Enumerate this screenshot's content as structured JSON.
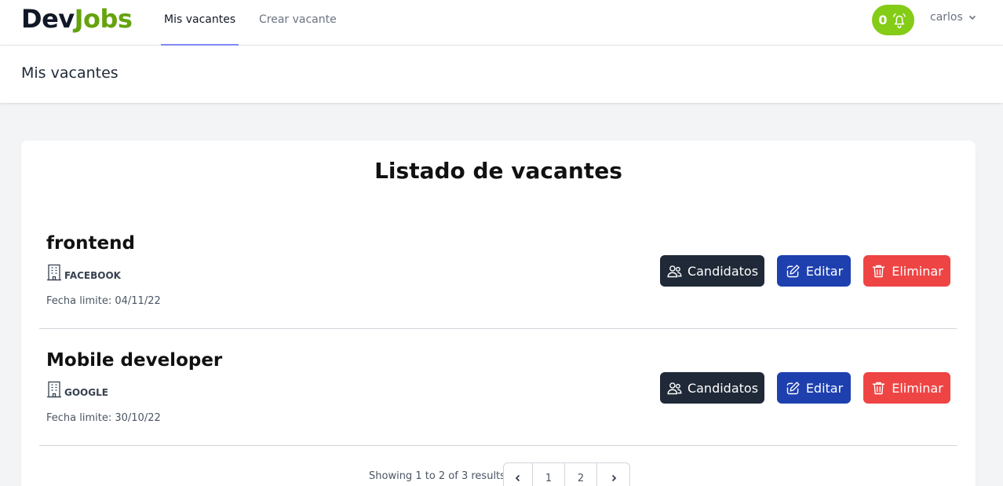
{
  "nav": {
    "logo_part1": "Dev",
    "logo_part2": "Jobs",
    "links": [
      {
        "label": "Mis vacantes",
        "active": true
      },
      {
        "label": "Crear vacante",
        "active": false
      }
    ],
    "notification_count": "0",
    "user_name": "carlos",
    "icons": {
      "notification": "bell-icon",
      "user_menu": "chevron-down-icon"
    }
  },
  "page_header": {
    "title": "Mis vacantes"
  },
  "card": {
    "title": "Listado de vacantes",
    "vacancies": [
      {
        "title": "frontend",
        "company": "FACEBOOK",
        "deadline": "Fecha limite: 04/11/22"
      },
      {
        "title": "Mobile developer",
        "company": "GOOGLE",
        "deadline": "Fecha limite: 30/10/22"
      }
    ],
    "buttons": {
      "candidates": "Candidatos",
      "edit": "Editar",
      "delete": "Eliminar"
    },
    "pagination": {
      "info": "Showing 1 to 2 of 3 results",
      "pages": [
        "1",
        "2"
      ]
    }
  },
  "colors": {
    "brand_green": "#65a30d",
    "notif_green": "#84cc16",
    "dark": "#1f2937",
    "blue": "#1e40af",
    "red": "#ef4444",
    "active_tab": "#818cf8"
  }
}
